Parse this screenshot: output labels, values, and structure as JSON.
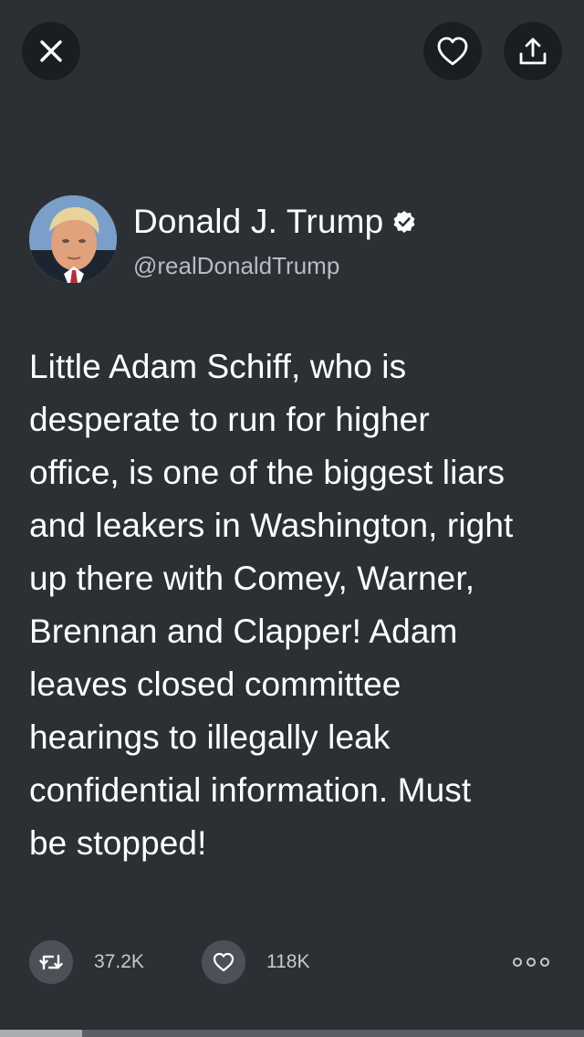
{
  "header": {
    "close_icon": "close-icon",
    "like_icon": "heart-outline-icon",
    "share_icon": "share-upload-icon"
  },
  "author": {
    "display_name": "Donald J. Trump",
    "handle": "@realDonaldTrump",
    "verified": true,
    "verified_icon": "verified-badge-icon"
  },
  "tweet": {
    "lines": [
      "Little Adam Schiff, who is",
      "desperate to run for higher",
      "office, is one of the biggest liars",
      "and leakers in Washington, right",
      "up there with Comey, Warner,",
      "Brennan and Clapper! Adam",
      "leaves closed committee",
      "hearings to illegally leak",
      "confidential information. Must",
      "be stopped!"
    ]
  },
  "actions": {
    "retweet_icon": "retweet-icon",
    "retweet_count": "37.2K",
    "like_icon": "heart-outline-icon",
    "like_count": "118K",
    "more_icon": "more-dots-icon"
  },
  "progress": {
    "fraction": 0.14
  },
  "colors": {
    "background": "#2c3035",
    "button_background": "#1b1e21",
    "action_circle": "#4c5157",
    "secondary_text": "#b8bcc2"
  }
}
